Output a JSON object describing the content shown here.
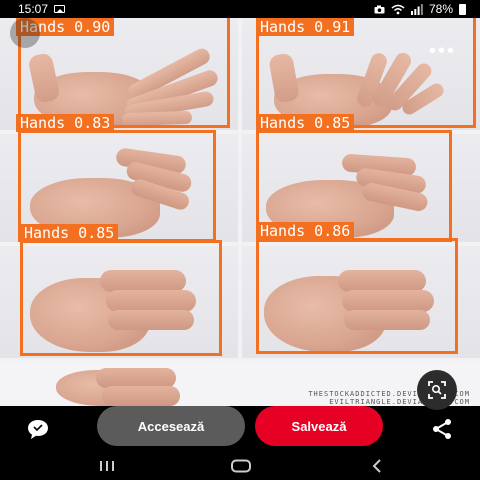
{
  "status_bar": {
    "time": "15:07",
    "battery": "78%"
  },
  "detections": [
    {
      "label": "Hands 0.90"
    },
    {
      "label": "Hands 0.91"
    },
    {
      "label": "Hands 0.83"
    },
    {
      "label": "Hands 0.85"
    },
    {
      "label": "Hands 0.85"
    },
    {
      "label": "Hands 0.86"
    }
  ],
  "watermark": {
    "line1": "THESTOCKADDICTED.DEVIANTART.COM",
    "line2": "EVILTRIANGLE.DEVIANTART.COM"
  },
  "actions": {
    "visit_label": "Accesează",
    "save_label": "Salvează"
  },
  "colors": {
    "detection": "#f37021",
    "save_button": "#e60023",
    "visit_button": "#5b5b5b"
  },
  "icons": [
    "image-icon",
    "camera-icon",
    "wifi-icon",
    "signal-icon",
    "battery-icon",
    "more-icon",
    "visual-search-icon",
    "comment-icon",
    "share-icon",
    "recent-apps-icon",
    "home-icon",
    "back-icon"
  ]
}
